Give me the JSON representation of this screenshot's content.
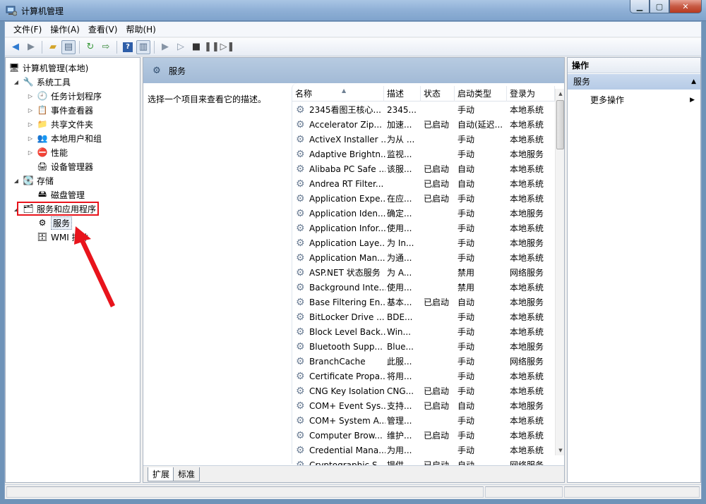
{
  "window": {
    "title": "计算机管理",
    "controls": [
      "minimize",
      "maximize",
      "close"
    ]
  },
  "menu": [
    "文件(F)",
    "操作(A)",
    "查看(V)",
    "帮助(H)"
  ],
  "tree": {
    "root": "计算机管理(本地)",
    "system_tools": "系统工具",
    "task_scheduler": "任务计划程序",
    "event_viewer": "事件查看器",
    "shared_folders": "共享文件夹",
    "local_users": "本地用户和组",
    "performance": "性能",
    "device_manager": "设备管理器",
    "storage": "存储",
    "disk_management": "磁盘管理",
    "services_apps": "服务和应用程序",
    "services": "服务",
    "wmi": "WMI 控件"
  },
  "middle": {
    "header": "服务",
    "description": "选择一个项目来查看它的描述。",
    "columns": [
      "名称",
      "描述",
      "状态",
      "启动类型",
      "登录为"
    ],
    "rows": [
      [
        "2345看图王核心...",
        "2345...",
        "",
        "手动",
        "本地系统"
      ],
      [
        "Accelerator  Zip...",
        "加速...",
        "已启动",
        "自动(延迟...",
        "本地系统"
      ],
      [
        "ActiveX Installer ...",
        "为从 ...",
        "",
        "手动",
        "本地系统"
      ],
      [
        "Adaptive Brightn...",
        "监视...",
        "",
        "手动",
        "本地服务"
      ],
      [
        "Alibaba PC Safe ...",
        "该服...",
        "已启动",
        "自动",
        "本地系统"
      ],
      [
        "Andrea RT Filter...",
        "",
        "已启动",
        "自动",
        "本地系统"
      ],
      [
        "Application Expe...",
        "在应...",
        "已启动",
        "手动",
        "本地系统"
      ],
      [
        "Application Iden...",
        "确定...",
        "",
        "手动",
        "本地服务"
      ],
      [
        "Application Infor...",
        "使用...",
        "",
        "手动",
        "本地系统"
      ],
      [
        "Application Laye...",
        "为 In...",
        "",
        "手动",
        "本地服务"
      ],
      [
        "Application Man...",
        "为通...",
        "",
        "手动",
        "本地系统"
      ],
      [
        "ASP.NET 状态服务",
        "为 A...",
        "",
        "禁用",
        "网络服务"
      ],
      [
        "Background Inte...",
        "使用...",
        "",
        "禁用",
        "本地系统"
      ],
      [
        "Base Filtering En...",
        "基本...",
        "已启动",
        "自动",
        "本地服务"
      ],
      [
        "BitLocker Drive ...",
        "BDE...",
        "",
        "手动",
        "本地系统"
      ],
      [
        "Block Level Back...",
        "Win...",
        "",
        "手动",
        "本地系统"
      ],
      [
        "Bluetooth Supp...",
        "Blue...",
        "",
        "手动",
        "本地服务"
      ],
      [
        "BranchCache",
        "此服...",
        "",
        "手动",
        "网络服务"
      ],
      [
        "Certificate Propa...",
        "将用...",
        "",
        "手动",
        "本地系统"
      ],
      [
        "CNG Key Isolation",
        "CNG...",
        "已启动",
        "手动",
        "本地系统"
      ],
      [
        "COM+ Event Sys...",
        "支持...",
        "已启动",
        "自动",
        "本地服务"
      ],
      [
        "COM+ System A...",
        "管理...",
        "",
        "手动",
        "本地系统"
      ],
      [
        "Computer Brow...",
        "维护...",
        "已启动",
        "手动",
        "本地系统"
      ],
      [
        "Credential Mana...",
        "为用...",
        "",
        "手动",
        "本地系统"
      ],
      [
        "Cryptographic S...",
        "提供...",
        "已启动",
        "自动",
        "网络服务"
      ]
    ],
    "tabs": [
      "扩展",
      "标准"
    ]
  },
  "actions": {
    "header": "操作",
    "group": "服务",
    "more": "更多操作"
  },
  "colors": {
    "annotation": "#e8141c",
    "header_blue": "#a2bad6"
  }
}
